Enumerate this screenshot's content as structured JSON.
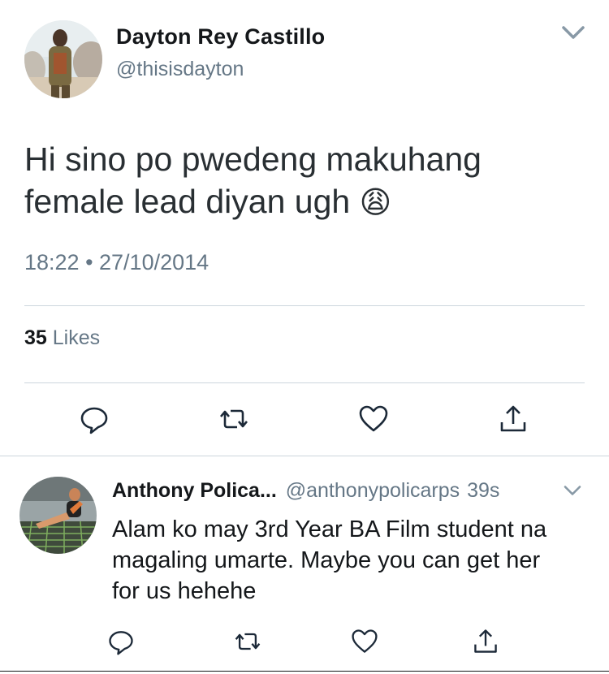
{
  "main_tweet": {
    "author_name": "Dayton Rey Castillo",
    "handle": "@thisisdayton",
    "text": "Hi sino po pwedeng makuhang female lead diyan ugh",
    "emoji": "😩",
    "timestamp": "18:22 • 27/10/2014",
    "likes_count": "35",
    "likes_label": "Likes",
    "actions": [
      "reply-icon",
      "retweet-icon",
      "like-icon",
      "share-icon"
    ]
  },
  "reply_tweet": {
    "author_name": "Anthony Polica...",
    "handle": "@anthonypolicarps",
    "time_ago": "39s",
    "text": "Alam ko may 3rd Year BA Film student na magaling umarte. Maybe you can get her for us hehehe",
    "actions": [
      "reply-icon",
      "retweet-icon",
      "like-icon",
      "share-icon"
    ]
  },
  "colors": {
    "text": "#14171a",
    "muted": "#657786",
    "divider": "#ccd6dd",
    "icon": "#1c2938"
  }
}
